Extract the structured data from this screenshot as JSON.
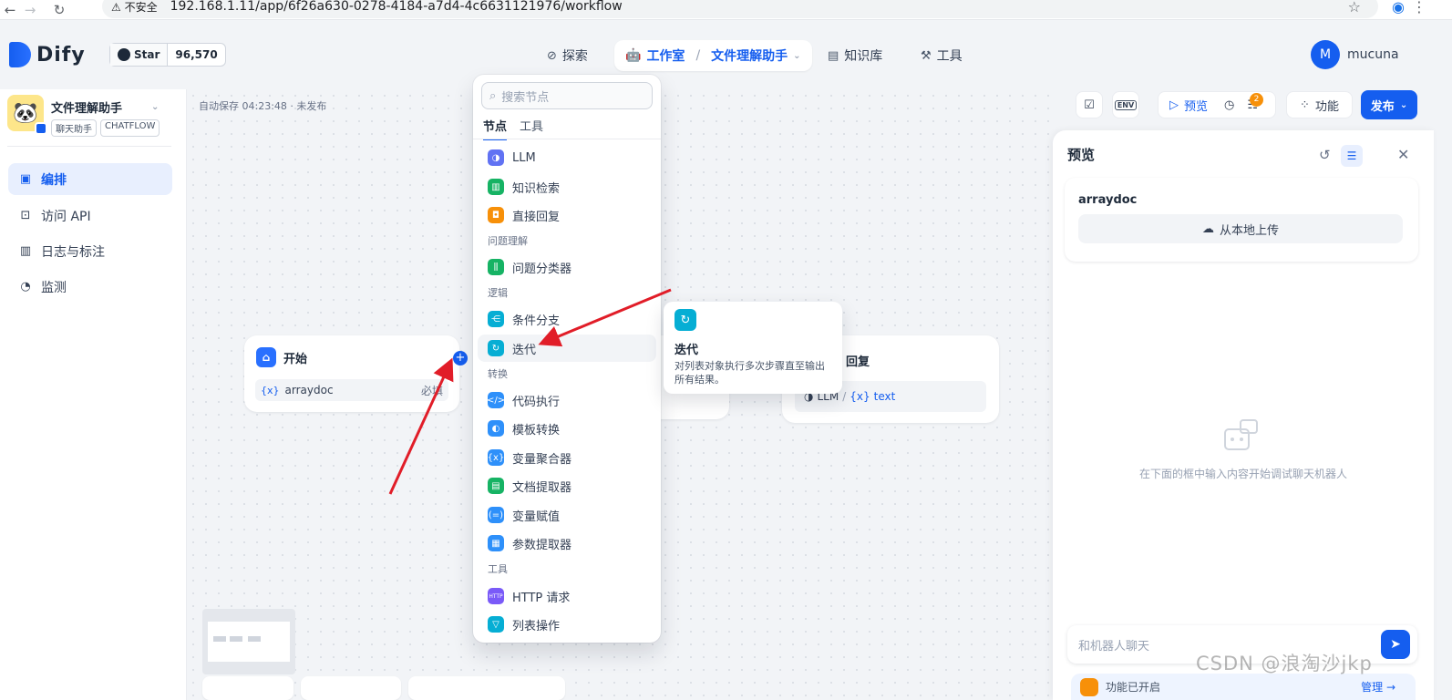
{
  "browser": {
    "security": "不安全",
    "url": "192.168.1.11/app/6f26a630-0278-4184-a7d4-4c6631121976/workflow"
  },
  "header": {
    "logo": "Dify",
    "github_star": "Star",
    "github_count": "96,570",
    "nav_explore": "探索",
    "nav_studio": "工作室",
    "nav_app": "文件理解助手",
    "nav_kb": "知识库",
    "nav_tools": "工具",
    "user_initial": "M",
    "user_name": "mucuna"
  },
  "sidebar": {
    "app_name": "文件理解助手",
    "tags": [
      "聊天助手",
      "CHATFLOW"
    ],
    "items": [
      {
        "label": "编排",
        "icon": "layout-icon",
        "active": true
      },
      {
        "label": "访问 API",
        "icon": "terminal-icon"
      },
      {
        "label": "日志与标注",
        "icon": "file-icon"
      },
      {
        "label": "监测",
        "icon": "gauge-icon"
      }
    ]
  },
  "canvas": {
    "autosave": "自动保存 04:23:48 · 未发布",
    "start_node": {
      "title": "开始",
      "var": "arraydoc",
      "required": "必填"
    },
    "answer_node": {
      "title": "回复",
      "source": "LLM",
      "var": "text"
    }
  },
  "picker": {
    "search_placeholder": "搜索节点",
    "tabs": [
      "节点",
      "工具"
    ],
    "items": {
      "llm": "LLM",
      "knowledge": "知识检索",
      "answer": "直接回复",
      "sec_understand": "问题理解",
      "classifier": "问题分类器",
      "sec_logic": "逻辑",
      "ifelse": "条件分支",
      "iteration": "迭代",
      "sec_transform": "转换",
      "code": "代码执行",
      "template": "模板转换",
      "aggregator": "变量聚合器",
      "doc_extract": "文档提取器",
      "assigner": "变量赋值",
      "param_extract": "参数提取器",
      "sec_tools": "工具",
      "http": "HTTP 请求",
      "list_op": "列表操作"
    }
  },
  "tooltip": {
    "title": "迭代",
    "desc": "对列表对象执行多次步骤直至输出所有结果。"
  },
  "toolbar": {
    "env": "ENV",
    "preview": "预览",
    "badge": "2",
    "features": "功能",
    "publish": "发布"
  },
  "preview": {
    "title": "预览",
    "field": "arraydoc",
    "upload": "从本地上传",
    "empty_hint": "在下面的框中输入内容开始调试聊天机器人",
    "input_placeholder": "和机器人聊天",
    "feature_text": "功能已开启",
    "manage": "管理 →"
  },
  "watermark": "CSDN @浪淘沙jkp",
  "colors": {
    "primary": "#155eef",
    "arrow": "#e11d28"
  }
}
